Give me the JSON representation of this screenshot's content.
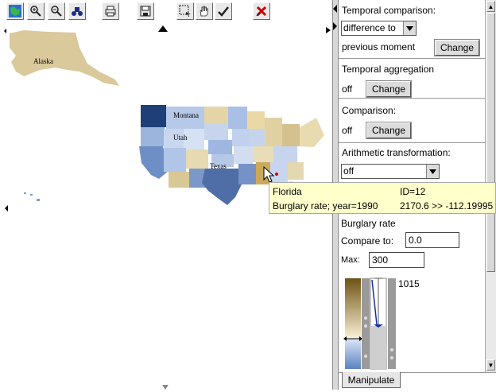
{
  "toolbar": {
    "icons": [
      "map-icon",
      "zoom-in-icon",
      "zoom-out-icon",
      "binoculars-icon",
      "print-icon",
      "save-icon",
      "select-rect-icon",
      "hand-icon",
      "check-icon",
      "close-icon"
    ]
  },
  "map": {
    "labels": {
      "alaska": "Alaska",
      "montana": "Montana",
      "utah": "Utah",
      "texas": "Texas"
    }
  },
  "tooltip": {
    "state": "Florida",
    "id": "ID=12",
    "attribute": "Burglary rate; year=1990",
    "value": "2170.6 >> -112.19995"
  },
  "panel": {
    "temporal_comparison": {
      "label": "Temporal comparison:",
      "select_value": "difference to",
      "sub_label": "previous moment",
      "button": "Change"
    },
    "temporal_aggregation": {
      "label": "Temporal aggregation",
      "state": "off",
      "button": "Change"
    },
    "comparison": {
      "label": "Comparison:",
      "state": "off",
      "button": "Change"
    },
    "arithmetic": {
      "label": "Arithmetic transformation:",
      "select_value": "off"
    },
    "legend": {
      "attribute": "Burglary rate",
      "compare_label": "Compare to:",
      "compare_value": "0.0",
      "max_label": "Max:",
      "max_value": "300",
      "top_value": "1015"
    }
  },
  "tabs": {
    "manipulate": "Manipulate"
  },
  "colors": {
    "positive": "#8c6d1f",
    "negative": "#3a5fa0",
    "tooltip_bg": "#ffffcc"
  }
}
